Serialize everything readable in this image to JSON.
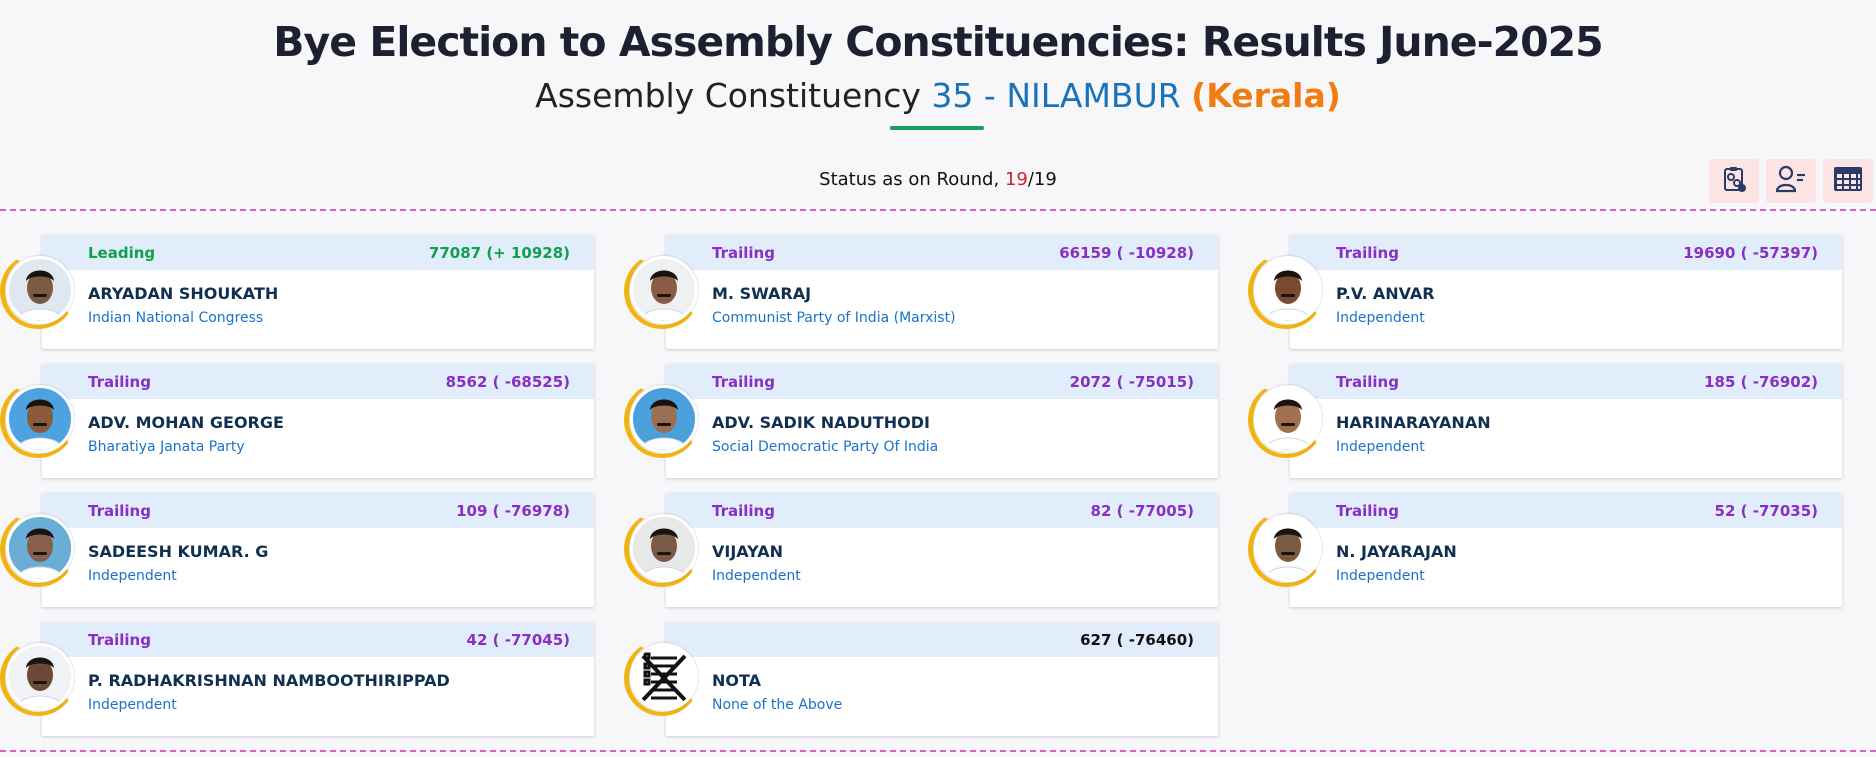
{
  "header": {
    "title": "Bye Election to Assembly Constituencies: Results June-2025",
    "subtitle_prefix": "Assembly Constituency",
    "ac_number": "35",
    "ac_dash": "-",
    "ac_name": "NILAMBUR",
    "state": "(Kerala)"
  },
  "status": {
    "prefix": "Status as on Round,",
    "current_round": "19",
    "separator": "/",
    "total_rounds": "19"
  },
  "toolbar": {
    "buttons": [
      {
        "icon": "clipboard-gear-icon"
      },
      {
        "icon": "user-list-icon"
      },
      {
        "icon": "table-grid-icon"
      }
    ]
  },
  "colors": {
    "leading": "#10a04a",
    "trailing": "#8a2fc0",
    "accent": "#1a73b8",
    "state": "#f07c12"
  },
  "candidates": [
    {
      "status": "Leading",
      "votes": "77087 (+ 10928)",
      "name": "ARYADAN SHOUKATH",
      "party": "Indian National Congress",
      "kind": "lead"
    },
    {
      "status": "Trailing",
      "votes": "66159 ( -10928)",
      "name": "M. SWARAJ",
      "party": "Communist Party of India (Marxist)",
      "kind": "trail"
    },
    {
      "status": "Trailing",
      "votes": "19690 ( -57397)",
      "name": "P.V. ANVAR",
      "party": "Independent",
      "kind": "trail"
    },
    {
      "status": "Trailing",
      "votes": "8562 ( -68525)",
      "name": "ADV. MOHAN GEORGE",
      "party": "Bharatiya Janata Party",
      "kind": "trail"
    },
    {
      "status": "Trailing",
      "votes": "2072 ( -75015)",
      "name": "ADV. SADIK NADUTHODI",
      "party": "Social Democratic Party Of India",
      "kind": "trail"
    },
    {
      "status": "Trailing",
      "votes": "185 ( -76902)",
      "name": "HARINARAYANAN",
      "party": "Independent",
      "kind": "trail"
    },
    {
      "status": "Trailing",
      "votes": "109 ( -76978)",
      "name": "SADEESH KUMAR. G",
      "party": "Independent",
      "kind": "trail"
    },
    {
      "status": "Trailing",
      "votes": "82 ( -77005)",
      "name": "VIJAYAN",
      "party": "Independent",
      "kind": "trail"
    },
    {
      "status": "Trailing",
      "votes": "52 ( -77035)",
      "name": "N. JAYARAJAN",
      "party": "Independent",
      "kind": "trail"
    },
    {
      "status": "Trailing",
      "votes": "42 ( -77045)",
      "name": "P. RADHAKRISHNAN NAMBOOTHIRIPPAD",
      "party": "Independent",
      "kind": "trail"
    },
    {
      "status": "",
      "votes": "627 ( -76460)",
      "name": "NOTA",
      "party": "None of the Above",
      "kind": "neutral",
      "nota": true
    }
  ]
}
